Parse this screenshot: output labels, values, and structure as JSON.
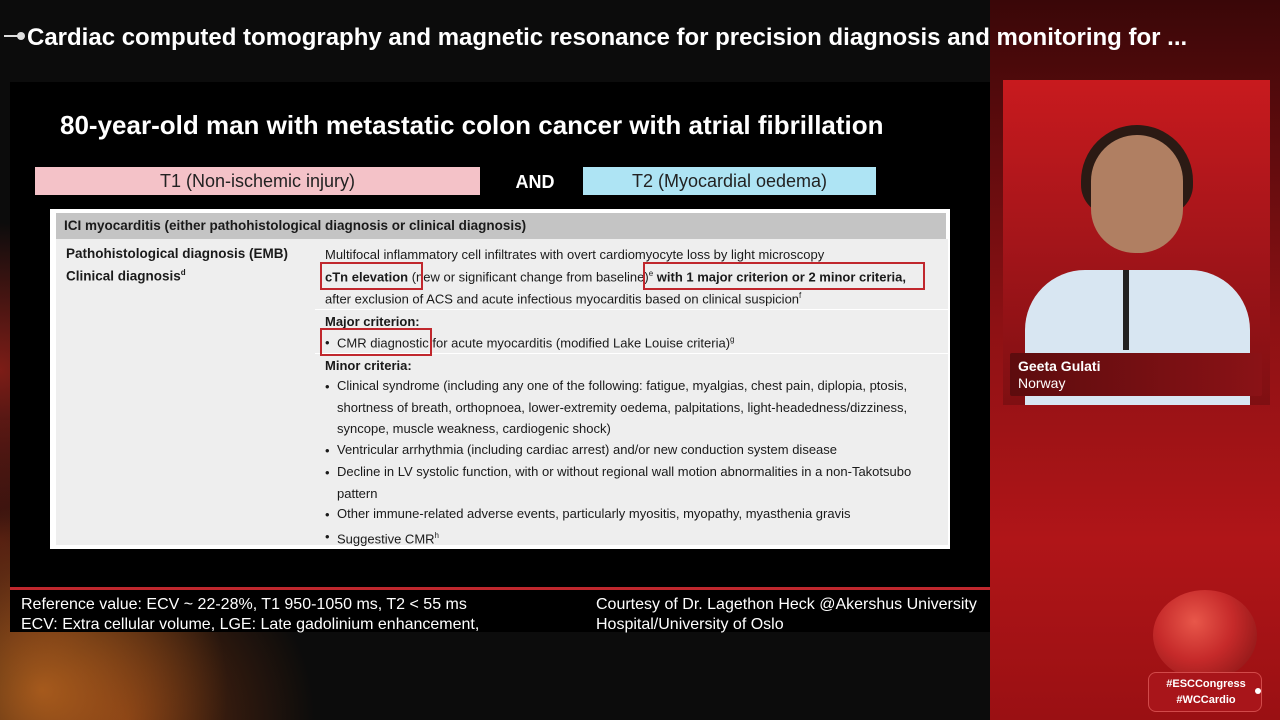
{
  "header": {
    "title": "Cardiac computed tomography and magnetic resonance for precision diagnosis and monitoring for ..."
  },
  "slide": {
    "title": "80-year-old man with metastatic colon cancer with atrial fibrillation",
    "t1_label": "T1 (Non-ischemic injury)",
    "and_label": "AND",
    "t2_label": "T2 (Myocardial oedema)",
    "table": {
      "heading": "ICI myocarditis (either pathohistological diagnosis or clinical diagnosis)",
      "row1_label": "Pathohistological diagnosis (EMB)",
      "row1_text": "Multifocal inflammatory cell infiltrates with overt cardiomyocyte loss by light microscopy",
      "row2_label": "Clinical diagnosis",
      "row2_label_sup": "d",
      "row2_bold1": "cTn elevation",
      "row2_mid": " (new or significant change from baseline)",
      "row2_sup1": "e",
      "row2_bold2": " with 1 major criterion or 2 minor criteria,",
      "row2_line2": "after exclusion of ACS and acute infectious myocarditis based on clinical suspicion",
      "row2_sup2": "f",
      "major_heading": "Major criterion:",
      "major_item": "CMR diagnostic for acute myocarditis (modified Lake Louise criteria)",
      "major_item_sup": "g",
      "minor_heading": "Minor criteria:",
      "minor_items": [
        "Clinical syndrome (including any one of the following: fatigue, myalgias, chest pain, diplopia, ptosis, shortness of breath, orthopnoea, lower-extremity oedema, palpitations, light-headedness/dizziness, syncope, muscle weakness, cardiogenic shock)",
        "Ventricular arrhythmia (including cardiac arrest) and/or new conduction system disease",
        "Decline in LV systolic function, with or without regional wall motion abnormalities in a non-Takotsubo pattern",
        "Other immune-related adverse events, particularly myositis, myopathy, myasthenia gravis",
        "Suggestive CMR"
      ],
      "minor_last_sup": "h",
      "bullet_char": "•"
    }
  },
  "footer": {
    "left_line1": "Reference value: ECV ~ 22-28%, T1 950-1050 ms, T2 < 55 ms",
    "left_line2": "ECV: Extra cellular volume, LGE: Late gadolinium enhancement,",
    "right_line1": "Courtesy of Dr. Lagethon Heck @Akershus University",
    "right_line2": "Hospital/University of Oslo"
  },
  "speaker": {
    "name": "Geeta Gulati",
    "country": "Norway"
  },
  "branding": {
    "hashtag1": "#ESCCongress",
    "hashtag2": "#WCCardio"
  },
  "colors": {
    "accent_red": "#c0272d",
    "t1_pink": "#f4c2c8",
    "t2_blue": "#aee4f4"
  }
}
